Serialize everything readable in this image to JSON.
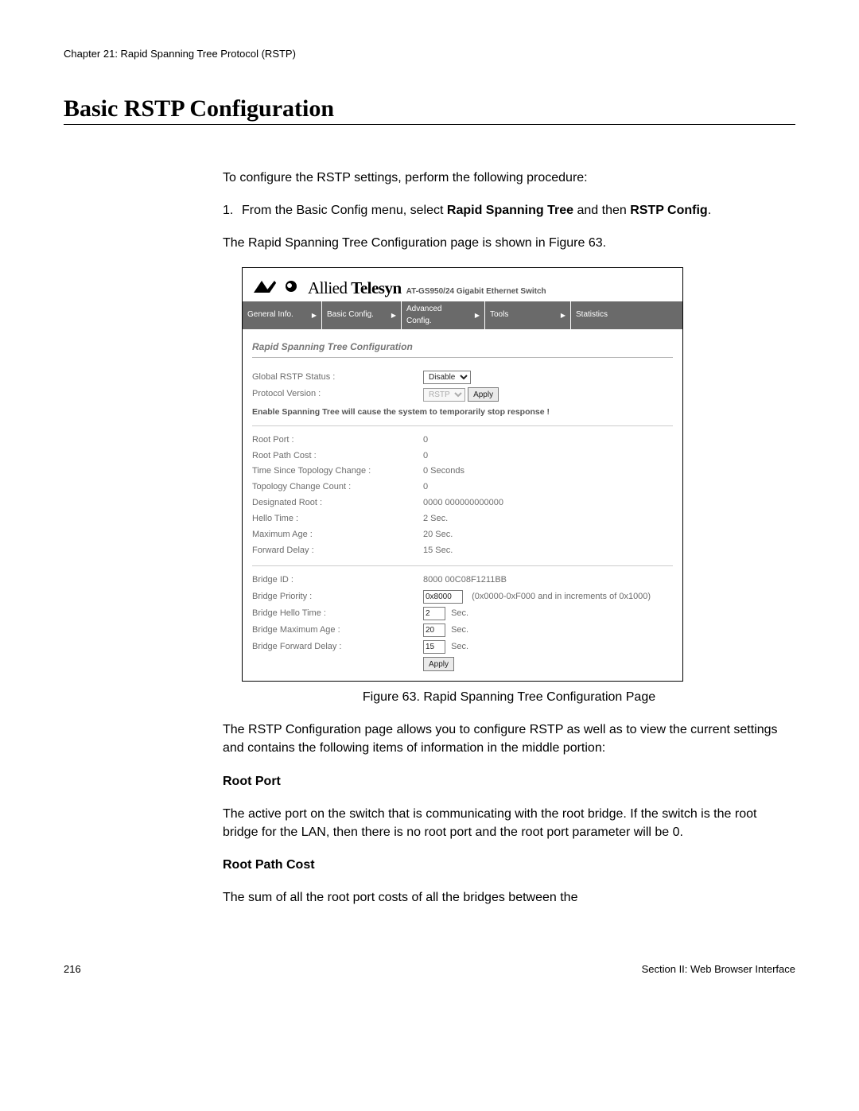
{
  "doc": {
    "chapter_header": "Chapter 21: Rapid Spanning Tree Protocol (RSTP)",
    "section_title": "Basic RSTP Configuration",
    "intro": "To configure the RSTP settings, perform the following procedure:",
    "step1_num": "1.",
    "step1_a": "From the Basic Config menu, select ",
    "step1_b": "Rapid Spanning Tree",
    "step1_c": " and then ",
    "step1_d": "RSTP Config",
    "step1_e": ".",
    "after_step": "The Rapid Spanning Tree Configuration page is shown in Figure 63.",
    "figure_caption": "Figure 63. Rapid Spanning Tree Configuration Page",
    "para_after_figure": "The RSTP Configuration page allows you to configure RSTP as well as to view the current settings and contains the following items of information in the middle portion:",
    "root_port_title": "Root Port",
    "root_port_desc": "The active port on the switch that is communicating with the root bridge. If the switch is the root bridge for the LAN, then there is no root port and the root port parameter will be 0.",
    "root_path_cost_title": "Root Path Cost",
    "root_path_cost_desc": "The sum of all the root port costs of all the bridges between the",
    "page_number": "216",
    "footer_right": "Section II: Web Browser Interface"
  },
  "ui": {
    "brand_allied": "Allied",
    "brand_telesyn": "Telesyn",
    "product": "AT-GS950/24 Gigabit Ethernet Switch",
    "menu": {
      "general_info": "General Info.",
      "basic_config": "Basic Config.",
      "advanced_config": "Advanced Config.",
      "tools": "Tools",
      "statistics": "Statistics"
    },
    "panel_title": "Rapid Spanning Tree Configuration",
    "labels": {
      "global_rstp_status": "Global RSTP Status :",
      "protocol_version": "Protocol Version :",
      "warning": "Enable Spanning Tree will cause the system to temporarily stop response !",
      "root_port": "Root Port :",
      "root_path_cost": "Root Path Cost :",
      "time_since_topology": "Time Since Topology Change :",
      "topology_change_count": "Topology Change Count :",
      "designated_root": "Designated Root :",
      "hello_time": "Hello Time :",
      "maximum_age": "Maximum Age :",
      "forward_delay": "Forward Delay :",
      "bridge_id": "Bridge ID :",
      "bridge_priority": "Bridge Priority :",
      "bridge_hello_time": "Bridge Hello Time :",
      "bridge_max_age": "Bridge Maximum Age :",
      "bridge_fwd_delay": "Bridge Forward Delay :"
    },
    "values": {
      "global_rstp_status": "Disable",
      "protocol_version": "RSTP",
      "apply": "Apply",
      "root_port": "0",
      "root_path_cost": "0",
      "time_since_topology": "0 Seconds",
      "topology_change_count": "0",
      "designated_root": "0000 000000000000",
      "hello_time": "2 Sec.",
      "maximum_age": "20 Sec.",
      "forward_delay": "15 Sec.",
      "bridge_id": "8000 00C08F1211BB",
      "bridge_priority": "0x8000",
      "bridge_priority_hint": "(0x0000-0xF000 and in increments of 0x1000)",
      "bridge_hello_time": "2",
      "bridge_max_age": "20",
      "bridge_fwd_delay": "15",
      "sec_suffix": "Sec."
    }
  }
}
